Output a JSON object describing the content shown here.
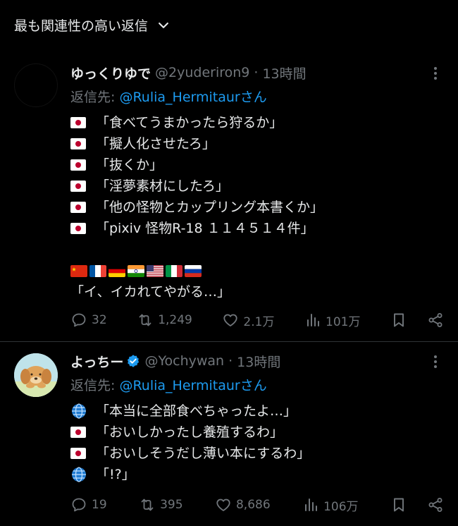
{
  "sort": {
    "label": "最も関連性の高い返信"
  },
  "posts": [
    {
      "display_name": "ゆっくりゆで",
      "handle": "@2yuderiron9",
      "time": "13時間",
      "reply_prefix": "返信先: ",
      "reply_mention": "@Rulia_Hermitaur",
      "reply_suffix": "さん",
      "lines": [
        "「食べてうまかったら狩るか」",
        "「擬人化させたろ」",
        "「抜くか」",
        "「淫夢素材にしたろ」",
        "「他の怪物とカップリング本書くか」",
        "「pixiv 怪物R-18 １１４５１４件」"
      ],
      "flags": [
        "cn",
        "fr",
        "de",
        "in",
        "us",
        "it",
        "ru"
      ],
      "last_line": "「イ、イカれてやがる…」",
      "stats": {
        "replies": "32",
        "reposts": "1,249",
        "likes": "2.1万",
        "views": "101万"
      }
    },
    {
      "display_name": "よっちー",
      "handle": "@Yochywan",
      "time": "13時間",
      "reply_prefix": "返信先: ",
      "reply_mention": "@Rulia_Hermitaur",
      "reply_suffix": "さん",
      "lines": [
        "「本当に全部食べちゃったよ…」",
        "「おいしかったし養殖するわ」",
        "「おいしそうだし薄い本にするわ」",
        "「!?」"
      ],
      "line_icons": [
        "globe",
        "jp",
        "jp",
        "globe"
      ],
      "stats": {
        "replies": "19",
        "reposts": "395",
        "likes": "8,686",
        "views": "106万"
      }
    }
  ],
  "colors": {
    "background": "#000000",
    "text": "#e7e9ea",
    "muted": "#71767b",
    "accent": "#1d9bf0"
  }
}
